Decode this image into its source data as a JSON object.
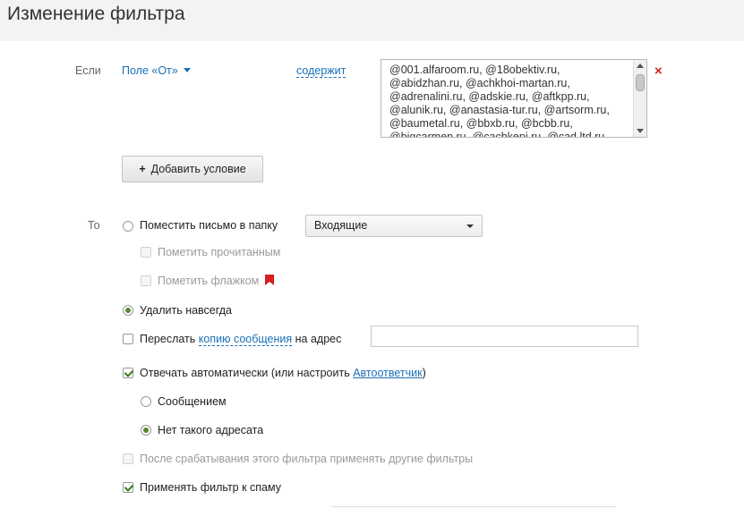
{
  "header": {
    "title": "Изменение фильтра"
  },
  "condition": {
    "if_label": "Если",
    "field_label": "Поле «От»",
    "operator_label": "содержит",
    "value_text": "@001.alfaroom.ru, @18obektiv.ru,\n@abidzhan.ru, @achkhoi-martan.ru,\n@adrenalini.ru, @adskie.ru, @aftkpp.ru,\n@alunik.ru, @anastasia-tur.ru, @artsorm.ru,\n@baumetal.ru, @bbxb.ru, @bcbb.ru,\n@bigcarmen.ru, @cachkepi.ru, @cad.ltd.ru",
    "remove_symbol": "×",
    "add_condition_label": "Добавить условие"
  },
  "actions": {
    "then_label": "То",
    "move_to_folder_label": "Поместить письмо в папку",
    "folder_select": {
      "selected": "Входящие"
    },
    "mark_read_label": "Пометить прочитанным",
    "mark_flag_label": "Пометить флажком",
    "delete_forever_label": "Удалить навсегда",
    "forward_prefix": "Переслать",
    "forward_link": "копию сообщения",
    "forward_suffix": "на адрес",
    "forward_address_value": "",
    "autoreply_prefix": "Отвечать автоматически (или настроить",
    "autoreply_link": "Автоответчик",
    "autoreply_suffix": ")",
    "reply_message_label": "Сообщением",
    "reply_no_such_user_label": "Нет такого адресата",
    "apply_other_filters_label": "После срабатывания этого фильтра применять другие фильтры",
    "apply_to_spam_label": "Применять фильтр к спаму"
  },
  "colors": {
    "accent_link": "#1a6fb8",
    "flag": "#d42020",
    "check": "#3a7a1a"
  }
}
